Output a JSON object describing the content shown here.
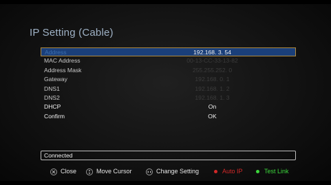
{
  "screen": {
    "title": "IP Setting (Cable)"
  },
  "settings": [
    {
      "label": "Address",
      "value": "192.168.  3. 54"
    },
    {
      "label": "MAC Address",
      "value": "00-13-CC-33-13-82"
    },
    {
      "label": "Address Mask",
      "value": "255.255.252.  0"
    },
    {
      "label": "Gateway",
      "value": "192.168.  0.  1"
    },
    {
      "label": "DNS1",
      "value": "192.168.  1.  2"
    },
    {
      "label": "DNS2",
      "value": "192.168.  1.  3"
    },
    {
      "label": "DHCP",
      "value": "On"
    },
    {
      "label": "Confirm",
      "value": "OK"
    }
  ],
  "status": {
    "text": "Connected"
  },
  "legend": {
    "close": "Close",
    "move_cursor": "Move Cursor",
    "change_setting": "Change Setting",
    "auto_ip": "Auto IP",
    "test_link": "Test Link"
  },
  "icons": {
    "close": "exit-key-icon",
    "move_cursor": "arrow-up-down-key-icon",
    "change_setting": "arrow-left-right-key-icon",
    "auto_ip": "red-key-icon",
    "test_link": "green-key-icon"
  },
  "colors": {
    "selected_row": "#1a3f7a",
    "selected_border": "#b08a3e",
    "auto_ip": "#d32828",
    "test_link": "#3cd83c",
    "title": "#9fb2c6"
  }
}
